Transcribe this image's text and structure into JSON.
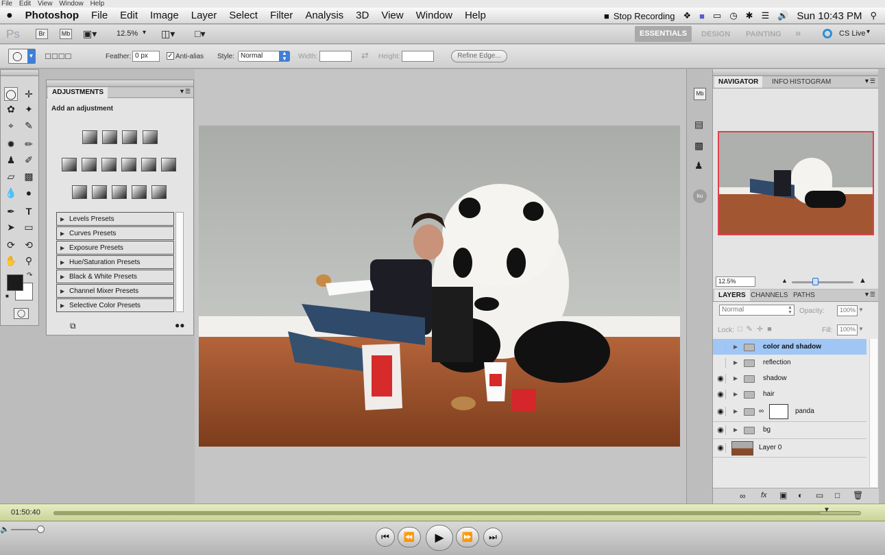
{
  "os_menu": {
    "items": [
      "File",
      "Edit",
      "View",
      "Window",
      "Help"
    ]
  },
  "menubar": {
    "app": "Photoshop",
    "items": [
      "File",
      "Edit",
      "Image",
      "Layer",
      "Select",
      "Filter",
      "Analysis",
      "3D",
      "View",
      "Window",
      "Help"
    ],
    "stop_recording": "Stop Recording",
    "clock": "Sun 10:43 PM"
  },
  "appbar": {
    "logo": "Ps",
    "br": "Br",
    "mb": "Mb",
    "zoom": "12.5%",
    "workspaces": [
      "ESSENTIALS",
      "DESIGN",
      "PAINTING"
    ],
    "more": "»",
    "cs_live": "CS Live"
  },
  "options": {
    "feather_label": "Feather:",
    "feather_value": "0 px",
    "antialias": "Anti-alias",
    "style_label": "Style:",
    "style_value": "Normal",
    "width_label": "Width:",
    "height_label": "Height:",
    "refine": "Refine Edge..."
  },
  "adjustments": {
    "tab": "ADJUSTMENTS",
    "subtitle": "Add an adjustment",
    "presets": [
      "Levels Presets",
      "Curves Presets",
      "Exposure Presets",
      "Hue/Saturation Presets",
      "Black & White Presets",
      "Channel Mixer Presets",
      "Selective Color Presets"
    ]
  },
  "navigator": {
    "tabs": [
      "NAVIGATOR",
      "INFO",
      "HISTOGRAM"
    ],
    "zoom": "12.5%"
  },
  "layers": {
    "tabs": [
      "LAYERS",
      "CHANNELS",
      "PATHS"
    ],
    "blend": "Normal",
    "opacity_label": "Opacity:",
    "opacity": "100%",
    "lock_label": "Lock:",
    "fill_label": "Fill:",
    "fill": "100%",
    "items": [
      {
        "name": "color and shadow"
      },
      {
        "name": "reflection"
      },
      {
        "name": "shadow"
      },
      {
        "name": "hair"
      },
      {
        "name": "panda"
      },
      {
        "name": "bg"
      },
      {
        "name": "Layer 0"
      }
    ]
  },
  "player": {
    "time": "01:50:40",
    "progress": 0.95
  },
  "colors": {
    "accent": "#9fc6f5",
    "nav_frame": "#e0404a"
  }
}
